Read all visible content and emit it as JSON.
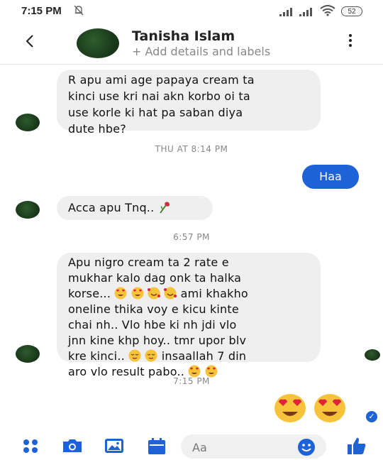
{
  "status_bar": {
    "time": "7:15 PM",
    "battery": "52",
    "mute_icon": "muted-bell-icon"
  },
  "header": {
    "contact_name": "Tanisha Islam",
    "subtitle": "+ Add details and labels",
    "back_icon": "back-arrow-icon",
    "more_icon": "more-vertical-icon"
  },
  "messages": [
    {
      "from": "contact",
      "text_lines": [
        "R apu ami age papaya cream ta",
        "kinci use kri nai akn korbo oi ta",
        "use korle ki hat pa saban diya",
        "dute hbe?"
      ]
    },
    {
      "type": "timestamp",
      "text": "THU AT 8:14 PM"
    },
    {
      "from": "me",
      "text": "Haa"
    },
    {
      "from": "contact",
      "text": "Acca apu Tnq..",
      "emoji": "wilted-rose"
    },
    {
      "type": "timestamp",
      "text": "6:57 PM"
    },
    {
      "from": "contact",
      "text_lines": [
        "Apu nigro cream ta 2 rate e",
        "mukhar kalo dag onk ta halka",
        "korse...",
        "ami khakho",
        "oneline thika voy e kicu kinte",
        "chai nh.. Vlo hbe ki nh jdi vlo",
        "jnn kine khp hoy.. tmr upor blv",
        "kre kinci..",
        "insaallah 7 din",
        "aro  vlo result pabo.."
      ]
    },
    {
      "type": "timestamp",
      "text": "7:15 PM"
    },
    {
      "from": "me",
      "emoji": "heart-eyes x2"
    }
  ],
  "composer": {
    "placeholder": "Aa",
    "icons": [
      "apps-grid-icon",
      "camera-icon",
      "image-icon",
      "calendar-icon",
      "emoji-smile-icon",
      "thumbs-up-icon"
    ]
  },
  "colors": {
    "accent": "#1d62d6",
    "bubble_gray": "#efefef"
  }
}
